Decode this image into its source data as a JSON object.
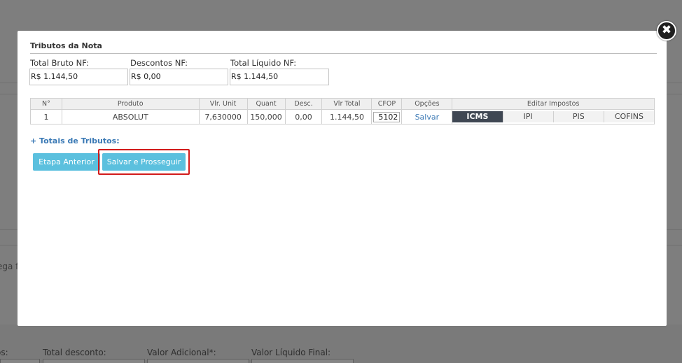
{
  "background": {
    "fragment_text": "ega fu",
    "bottom_labels": [
      "os:",
      "Total desconto:",
      "Valor Adicional*:",
      "Valor Líquido Final:"
    ]
  },
  "modal": {
    "close_symbol": "✖",
    "section_title": "Tributos da Nota",
    "fields": [
      {
        "label": "Total Bruto NF:",
        "value": "R$ 1.144,50"
      },
      {
        "label": "Descontos NF:",
        "value": "R$ 0,00"
      },
      {
        "label": "Total Líquido NF:",
        "value": "R$ 1.144,50"
      }
    ],
    "table": {
      "headers": [
        "N°",
        "Produto",
        "Vlr. Unit",
        "Quant",
        "Desc.",
        "Vlr Total",
        "CFOP",
        "Opções",
        "Editar Impostos"
      ],
      "row": {
        "num": "1",
        "produto": "ABSOLUT",
        "vlr_unit": "7,630000",
        "quant": "150,000",
        "desc": "0,00",
        "vlr_total": "1.144,50",
        "cfop": "5102",
        "opcao": "Salvar"
      },
      "tax_tabs": [
        "ICMS",
        "IPI",
        "PIS",
        "COFINS"
      ],
      "active_tax_tab": "ICMS"
    },
    "totais_link": "+ Totais de Tributos:",
    "buttons": {
      "previous": "Etapa Anterior",
      "save_continue": "Salvar e Prosseguir"
    }
  },
  "colors": {
    "accent_button": "#5bc0de",
    "active_tab": "#3f4753",
    "link": "#3a79b5",
    "highlight": "#d21b1b"
  }
}
